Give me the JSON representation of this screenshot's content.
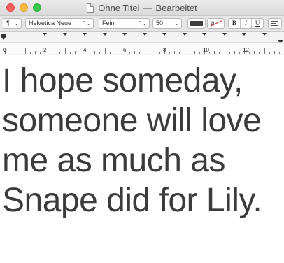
{
  "window": {
    "title": "Ohne Titel",
    "separator": "—",
    "status": "Bearbeitet"
  },
  "toolbar": {
    "paragraph_icon": "¶",
    "font_family": "Helvetica Neue",
    "font_style": "Fein",
    "font_size": "50",
    "stepper_icon": "⌃⌄",
    "bold_label": "B",
    "italic_label": "I",
    "underline_label": "U",
    "bg_color_glyph": "a",
    "text_color": "#3d3d3d"
  },
  "ruler": {
    "labels": [
      "0",
      "2",
      "4",
      "6",
      "8",
      "10",
      "12"
    ]
  },
  "document": {
    "text": "I hope someday,\nsomeone will love\nme as much as\nSnape did for Lily."
  }
}
